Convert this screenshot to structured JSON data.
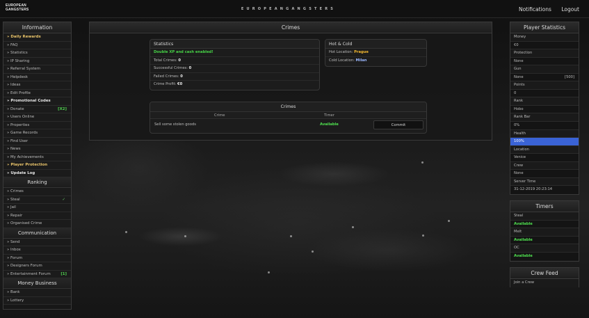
{
  "topbar": {
    "logo_line1": "European",
    "logo_line2": "Gangsters",
    "brand": "EUROPEANGANGSTERS",
    "notifications": "Notifications",
    "logout": "Logout"
  },
  "left": {
    "information_title": "Information",
    "information_items": [
      {
        "label": "» Daily Rewards",
        "style": "hl"
      },
      {
        "label": "» FAQ"
      },
      {
        "label": "» Statistics"
      },
      {
        "label": "» IP Sharing"
      },
      {
        "label": "» Referral System"
      },
      {
        "label": "» Helpdesk"
      },
      {
        "label": "» Ideas"
      },
      {
        "label": "» Edit Profile"
      },
      {
        "label": "» Promotional Codes",
        "style": "bold"
      },
      {
        "label": "» Donate",
        "tag": "[X2]"
      },
      {
        "label": "» Users Online"
      },
      {
        "label": "» Properties"
      },
      {
        "label": "» Game Records"
      },
      {
        "label": "» Find User"
      },
      {
        "label": "» News"
      },
      {
        "label": "» My Achievements"
      },
      {
        "label": "» Player Protection",
        "style": "hl"
      },
      {
        "label": "» Update Log",
        "style": "bold"
      }
    ],
    "ranking_title": "Ranking",
    "ranking_items": [
      {
        "label": "» Crimes"
      },
      {
        "label": "» Steal",
        "check": "✓"
      },
      {
        "label": "» Jail"
      },
      {
        "label": "» Repair"
      },
      {
        "label": "» Organised Crime"
      }
    ],
    "communication_title": "Communication",
    "communication_items": [
      {
        "label": "» Send"
      },
      {
        "label": "» Inbox"
      },
      {
        "label": "» Forum"
      },
      {
        "label": "» Designers Forum"
      },
      {
        "label": "» Entertainment Forum",
        "tag": "[1]"
      }
    ],
    "money_title": "Money Business",
    "money_items": [
      {
        "label": "» Bank"
      },
      {
        "label": "» Lottery"
      }
    ]
  },
  "main": {
    "title": "Crimes",
    "statistics": {
      "title": "Statistics",
      "notice": "Double XP and cash enabled!",
      "total_label": "Total Crimes: ",
      "total": "0",
      "success_label": "Successful Crimes: ",
      "success": "0",
      "failed_label": "Failed Crimes: ",
      "failed": "0",
      "profit_label": "Crime Profit: ",
      "profit": "€0"
    },
    "hotcold": {
      "title": "Hot & Cold",
      "hot_label": "Hot Location: ",
      "hot": "Prague",
      "cold_label": "Cold Location: ",
      "cold": "Milan"
    },
    "crimes_table": {
      "title": "Crimes",
      "col_crime": "Crime",
      "col_timer": "Timer",
      "rows": [
        {
          "crime": "Sell some stolen goods",
          "timer": "Available",
          "action": "Commit"
        }
      ]
    }
  },
  "right": {
    "stats_title": "Player Statistics",
    "stats": [
      {
        "label": "Money"
      },
      {
        "value": "€0"
      },
      {
        "label": "Protection"
      },
      {
        "value": "None"
      },
      {
        "label": "Gun"
      },
      {
        "value": "None",
        "extra": "[500]"
      },
      {
        "label": "Points"
      },
      {
        "value": "0"
      },
      {
        "label": "Rank"
      },
      {
        "value": "Hobo"
      },
      {
        "label": "Rank Bar"
      },
      {
        "value": "0%"
      },
      {
        "label": "Health"
      },
      {
        "value": "100%",
        "health": true
      },
      {
        "label": "Location"
      },
      {
        "value": "Venice"
      },
      {
        "label": "Crew"
      },
      {
        "value": "None"
      },
      {
        "label": "Server Time"
      },
      {
        "value": "31-12-2019 20:23:14"
      }
    ],
    "health_percent": 100,
    "health_color": "#3a63d6",
    "timers_title": "Timers",
    "timers": [
      {
        "label": "Steal",
        "status": "Available"
      },
      {
        "label": "Melt",
        "status": "Available"
      },
      {
        "label": "OC",
        "status": "Available"
      }
    ],
    "crewfeed_title": "Crew Feed",
    "crewfeed_link": "Join a Crew"
  }
}
